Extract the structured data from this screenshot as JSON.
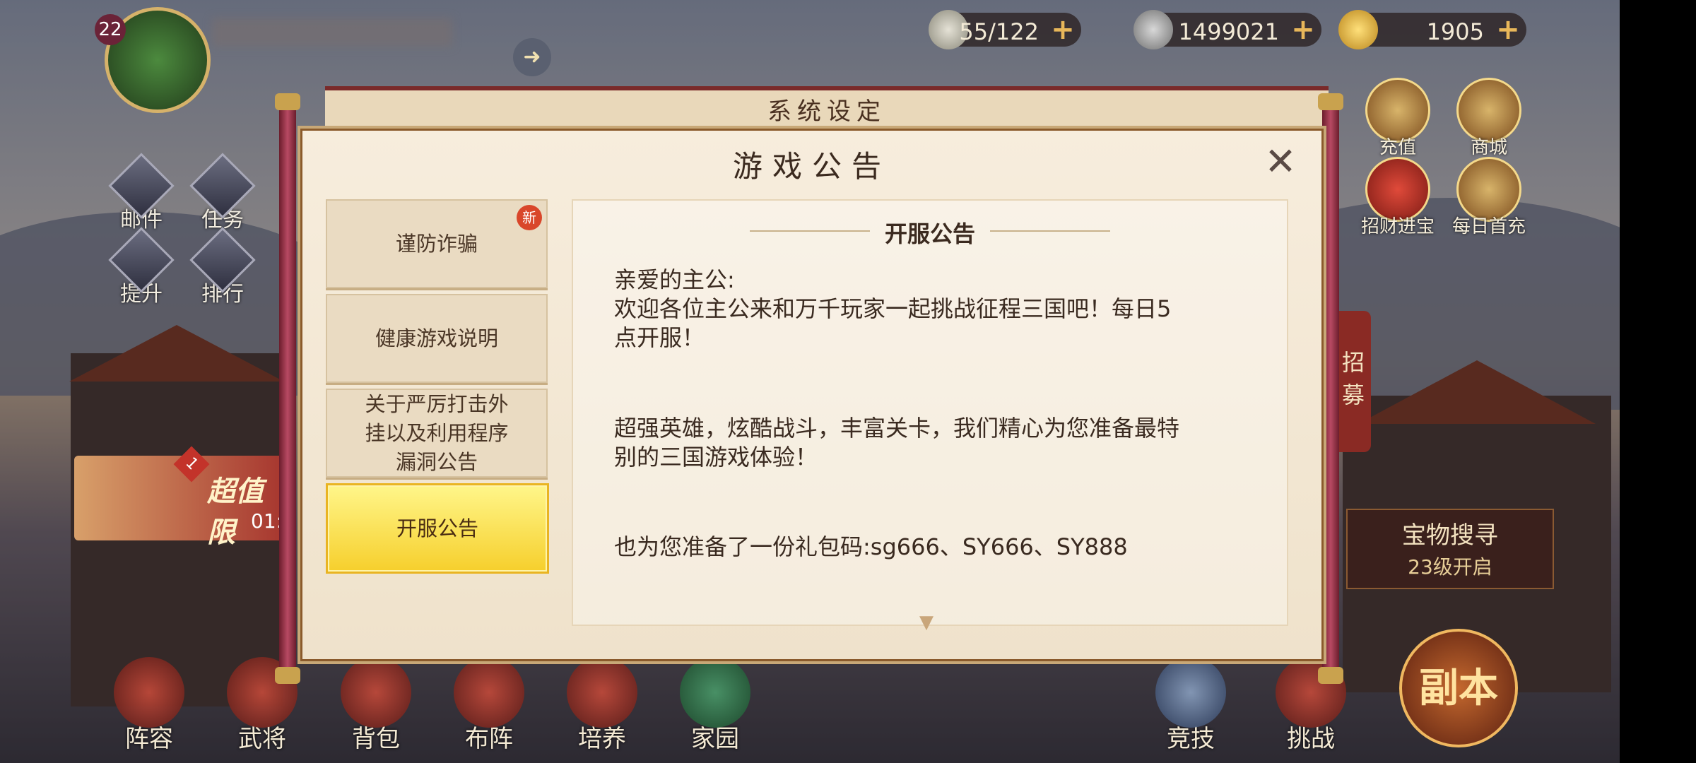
{
  "hud": {
    "player_level": "22",
    "stamina": "55/122",
    "copper": "1499021",
    "gold": "1905",
    "plus": "+"
  },
  "left_menu": [
    {
      "label": "邮件"
    },
    {
      "label": "任务"
    },
    {
      "label": "提升"
    },
    {
      "label": "排行"
    }
  ],
  "right_menu": [
    {
      "label": "充值"
    },
    {
      "label": "商城"
    },
    {
      "label": "招财进宝"
    },
    {
      "label": "每日首充"
    }
  ],
  "side_banner": {
    "recruit": "招\n募",
    "treasure_title": "宝物搜寻",
    "treasure_sub": "23级开启",
    "promo_badge": "1",
    "promo_text": "超值限",
    "promo_time": "01:"
  },
  "bottom_nav": [
    {
      "label": "阵容"
    },
    {
      "label": "武将"
    },
    {
      "label": "背包"
    },
    {
      "label": "布阵"
    },
    {
      "label": "培养"
    },
    {
      "label": "家园"
    },
    {
      "label": "竞技"
    },
    {
      "label": "挑战"
    }
  ],
  "dungeon_label": "副本",
  "behind_title": "系统设定",
  "dialog": {
    "title": "游戏公告",
    "close": "✕",
    "tabs": [
      {
        "label": "谨防诈骗",
        "badge": "新"
      },
      {
        "label": "健康游戏说明"
      },
      {
        "label": "关于严厉打击外\n挂以及利用程序\n漏洞公告"
      },
      {
        "label": "开服公告"
      }
    ],
    "content_title": "开服公告",
    "paragraphs": [
      "亲爱的主公:\n欢迎各位主公来和万千玩家一起挑战征程三国吧！每日5\n点开服！",
      "超强英雄，炫酷战斗，丰富关卡，我们精心为您准备最特\n别的三国游戏体验！",
      "也为您准备了一份礼包码:sg666、SY666、SY888"
    ]
  },
  "colors": {
    "accent": "#f6cf2c",
    "panel": "#f3e6d0",
    "text": "#3a2a20"
  }
}
